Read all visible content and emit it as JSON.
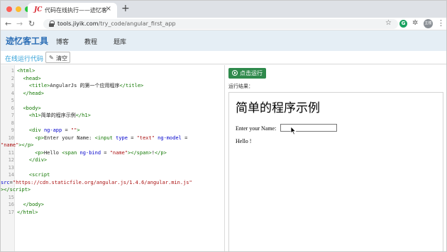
{
  "browser": {
    "tab_title": "代码在线执行——迹忆客",
    "tab_favicon": "JC",
    "tab_close": "×",
    "new_tab": "+",
    "url_host": "tools.jiyik.com",
    "url_path": "/try_code/angular_first_app",
    "avatar_label": "主楼"
  },
  "site": {
    "logo": "迹忆客工具",
    "nav": [
      "博客",
      "教程",
      "题库"
    ]
  },
  "toolbar": {
    "run_online_label": "在线运行代码",
    "clear_label": "清空"
  },
  "editor": {
    "line_numbers": [
      "1",
      "2",
      "3",
      "4",
      "5",
      "6",
      "7",
      "8",
      "9",
      "10",
      "11",
      "12",
      "13",
      "14",
      "15",
      "16",
      "17"
    ]
  },
  "result": {
    "run_button_label": "点击运行",
    "result_label": "运行结果：",
    "preview_heading": "简单的程序示例",
    "preview_input_label": "Enter your Name:",
    "preview_input_value": "",
    "preview_hello": "Hello !"
  },
  "colors": {
    "header_bg": "#e5eef5",
    "logo_blue": "#2a6db5",
    "run_button_green": "#2f8a4c",
    "link_blue": "#31a0d8",
    "code_tag_green": "#117700",
    "code_attr_blue": "#0000cc",
    "code_string_red": "#aa1111"
  },
  "icons": {
    "back": "back-arrow-icon",
    "forward": "forward-arrow-icon",
    "reload": "reload-icon",
    "lock": "lock-icon",
    "star": "bookmark-star-icon",
    "extension": "puzzle-icon",
    "menu": "kebab-menu-icon",
    "clear": "eraser-icon",
    "run": "play-circle-icon"
  }
}
